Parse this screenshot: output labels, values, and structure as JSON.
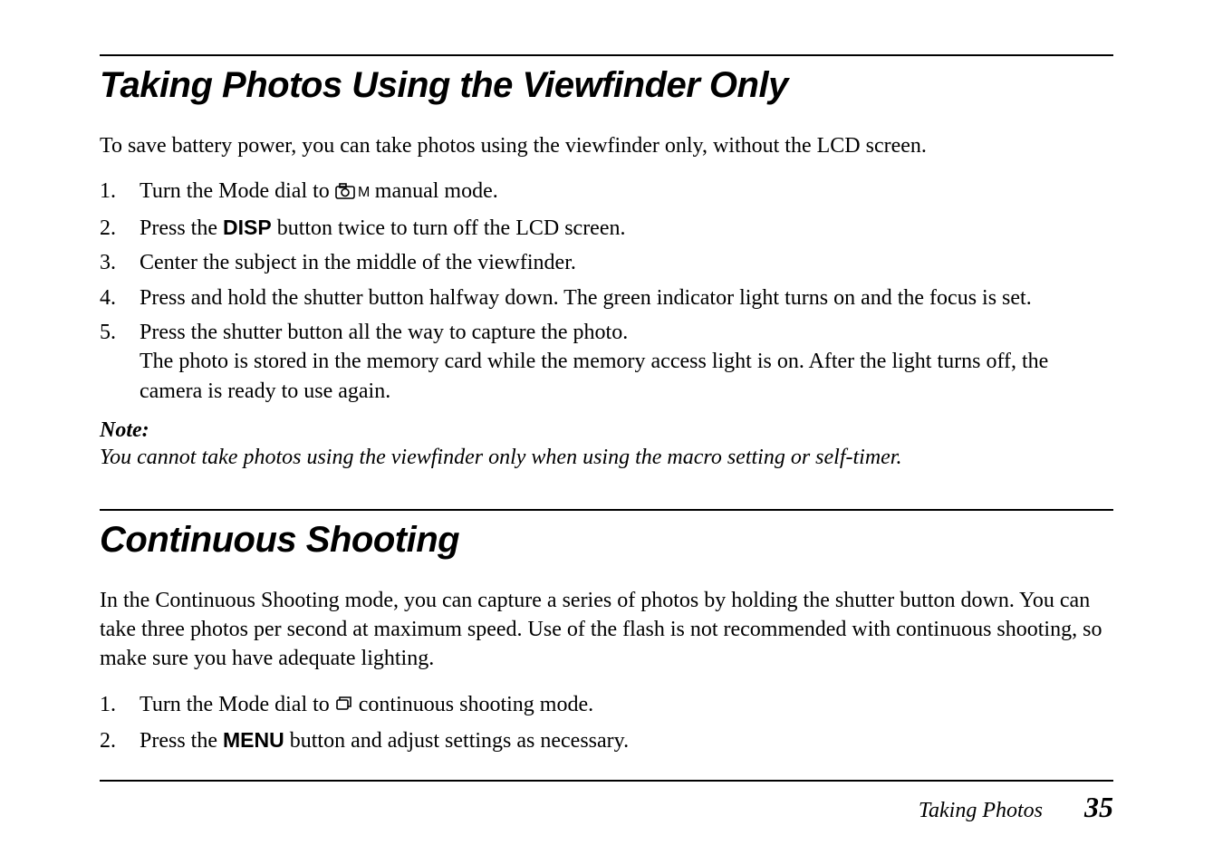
{
  "section1": {
    "title": "Taking Photos Using the Viewfinder Only",
    "intro": "To save battery power, you can take photos using the viewfinder only, without the LCD screen.",
    "steps": {
      "s1a": "Turn the Mode dial to ",
      "s1b": " manual mode.",
      "s2a": "Press the ",
      "s2disp": "DISP",
      "s2b": " button twice to turn off the LCD screen.",
      "s3": "Center the subject in the middle of the viewfinder.",
      "s4": "Press and hold the shutter button halfway down. The green indicator light turns on and the focus is set.",
      "s5a": "Press the shutter button all the way to capture the photo.",
      "s5b": "The photo is stored in the memory card while the memory access light is on. After the light turns off, the camera is ready to use again."
    },
    "note_label": "Note:",
    "note_text": "You cannot take photos using the viewfinder only when using the macro setting or self-timer."
  },
  "section2": {
    "title": "Continuous Shooting",
    "intro": "In the Continuous Shooting mode, you can capture a series of photos by holding the shutter button down. You can take three photos per second at maximum speed. Use of the flash is not recommended with continuous shooting, so make sure you have adequate lighting.",
    "steps": {
      "s1a": "Turn the Mode dial to ",
      "s1b": " continuous shooting mode.",
      "s2a": "Press the ",
      "s2menu": "MENU",
      "s2b": " button and adjust settings as necessary."
    }
  },
  "footer": {
    "section_name": "Taking Photos",
    "page_number": "35"
  },
  "list_nums": {
    "n1": "1.",
    "n2": "2.",
    "n3": "3.",
    "n4": "4.",
    "n5": "5."
  }
}
